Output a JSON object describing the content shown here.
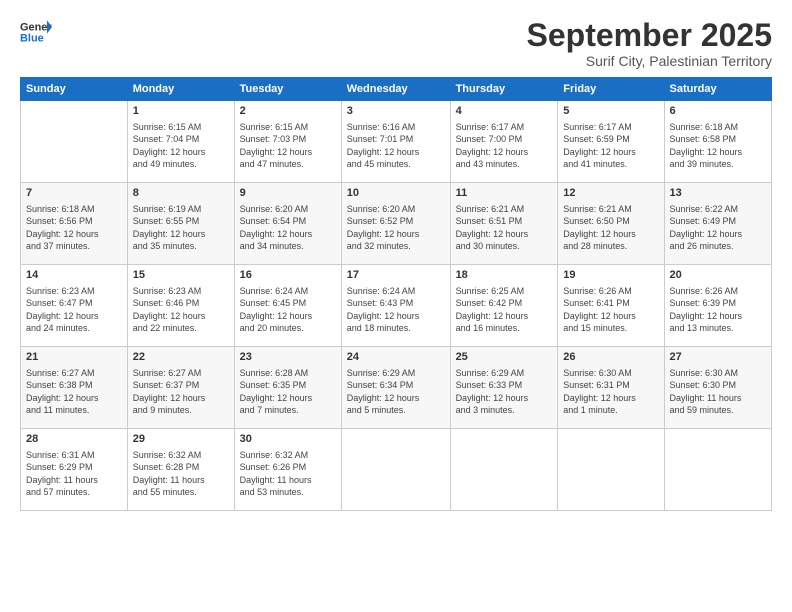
{
  "logo": {
    "line1": "General",
    "line2": "Blue"
  },
  "title": "September 2025",
  "subtitle": "Surif City, Palestinian Territory",
  "header_days": [
    "Sunday",
    "Monday",
    "Tuesday",
    "Wednesday",
    "Thursday",
    "Friday",
    "Saturday"
  ],
  "weeks": [
    [
      {
        "day": "",
        "info": ""
      },
      {
        "day": "1",
        "info": "Sunrise: 6:15 AM\nSunset: 7:04 PM\nDaylight: 12 hours\nand 49 minutes."
      },
      {
        "day": "2",
        "info": "Sunrise: 6:15 AM\nSunset: 7:03 PM\nDaylight: 12 hours\nand 47 minutes."
      },
      {
        "day": "3",
        "info": "Sunrise: 6:16 AM\nSunset: 7:01 PM\nDaylight: 12 hours\nand 45 minutes."
      },
      {
        "day": "4",
        "info": "Sunrise: 6:17 AM\nSunset: 7:00 PM\nDaylight: 12 hours\nand 43 minutes."
      },
      {
        "day": "5",
        "info": "Sunrise: 6:17 AM\nSunset: 6:59 PM\nDaylight: 12 hours\nand 41 minutes."
      },
      {
        "day": "6",
        "info": "Sunrise: 6:18 AM\nSunset: 6:58 PM\nDaylight: 12 hours\nand 39 minutes."
      }
    ],
    [
      {
        "day": "7",
        "info": "Sunrise: 6:18 AM\nSunset: 6:56 PM\nDaylight: 12 hours\nand 37 minutes."
      },
      {
        "day": "8",
        "info": "Sunrise: 6:19 AM\nSunset: 6:55 PM\nDaylight: 12 hours\nand 35 minutes."
      },
      {
        "day": "9",
        "info": "Sunrise: 6:20 AM\nSunset: 6:54 PM\nDaylight: 12 hours\nand 34 minutes."
      },
      {
        "day": "10",
        "info": "Sunrise: 6:20 AM\nSunset: 6:52 PM\nDaylight: 12 hours\nand 32 minutes."
      },
      {
        "day": "11",
        "info": "Sunrise: 6:21 AM\nSunset: 6:51 PM\nDaylight: 12 hours\nand 30 minutes."
      },
      {
        "day": "12",
        "info": "Sunrise: 6:21 AM\nSunset: 6:50 PM\nDaylight: 12 hours\nand 28 minutes."
      },
      {
        "day": "13",
        "info": "Sunrise: 6:22 AM\nSunset: 6:49 PM\nDaylight: 12 hours\nand 26 minutes."
      }
    ],
    [
      {
        "day": "14",
        "info": "Sunrise: 6:23 AM\nSunset: 6:47 PM\nDaylight: 12 hours\nand 24 minutes."
      },
      {
        "day": "15",
        "info": "Sunrise: 6:23 AM\nSunset: 6:46 PM\nDaylight: 12 hours\nand 22 minutes."
      },
      {
        "day": "16",
        "info": "Sunrise: 6:24 AM\nSunset: 6:45 PM\nDaylight: 12 hours\nand 20 minutes."
      },
      {
        "day": "17",
        "info": "Sunrise: 6:24 AM\nSunset: 6:43 PM\nDaylight: 12 hours\nand 18 minutes."
      },
      {
        "day": "18",
        "info": "Sunrise: 6:25 AM\nSunset: 6:42 PM\nDaylight: 12 hours\nand 16 minutes."
      },
      {
        "day": "19",
        "info": "Sunrise: 6:26 AM\nSunset: 6:41 PM\nDaylight: 12 hours\nand 15 minutes."
      },
      {
        "day": "20",
        "info": "Sunrise: 6:26 AM\nSunset: 6:39 PM\nDaylight: 12 hours\nand 13 minutes."
      }
    ],
    [
      {
        "day": "21",
        "info": "Sunrise: 6:27 AM\nSunset: 6:38 PM\nDaylight: 12 hours\nand 11 minutes."
      },
      {
        "day": "22",
        "info": "Sunrise: 6:27 AM\nSunset: 6:37 PM\nDaylight: 12 hours\nand 9 minutes."
      },
      {
        "day": "23",
        "info": "Sunrise: 6:28 AM\nSunset: 6:35 PM\nDaylight: 12 hours\nand 7 minutes."
      },
      {
        "day": "24",
        "info": "Sunrise: 6:29 AM\nSunset: 6:34 PM\nDaylight: 12 hours\nand 5 minutes."
      },
      {
        "day": "25",
        "info": "Sunrise: 6:29 AM\nSunset: 6:33 PM\nDaylight: 12 hours\nand 3 minutes."
      },
      {
        "day": "26",
        "info": "Sunrise: 6:30 AM\nSunset: 6:31 PM\nDaylight: 12 hours\nand 1 minute."
      },
      {
        "day": "27",
        "info": "Sunrise: 6:30 AM\nSunset: 6:30 PM\nDaylight: 11 hours\nand 59 minutes."
      }
    ],
    [
      {
        "day": "28",
        "info": "Sunrise: 6:31 AM\nSunset: 6:29 PM\nDaylight: 11 hours\nand 57 minutes."
      },
      {
        "day": "29",
        "info": "Sunrise: 6:32 AM\nSunset: 6:28 PM\nDaylight: 11 hours\nand 55 minutes."
      },
      {
        "day": "30",
        "info": "Sunrise: 6:32 AM\nSunset: 6:26 PM\nDaylight: 11 hours\nand 53 minutes."
      },
      {
        "day": "",
        "info": ""
      },
      {
        "day": "",
        "info": ""
      },
      {
        "day": "",
        "info": ""
      },
      {
        "day": "",
        "info": ""
      }
    ]
  ]
}
